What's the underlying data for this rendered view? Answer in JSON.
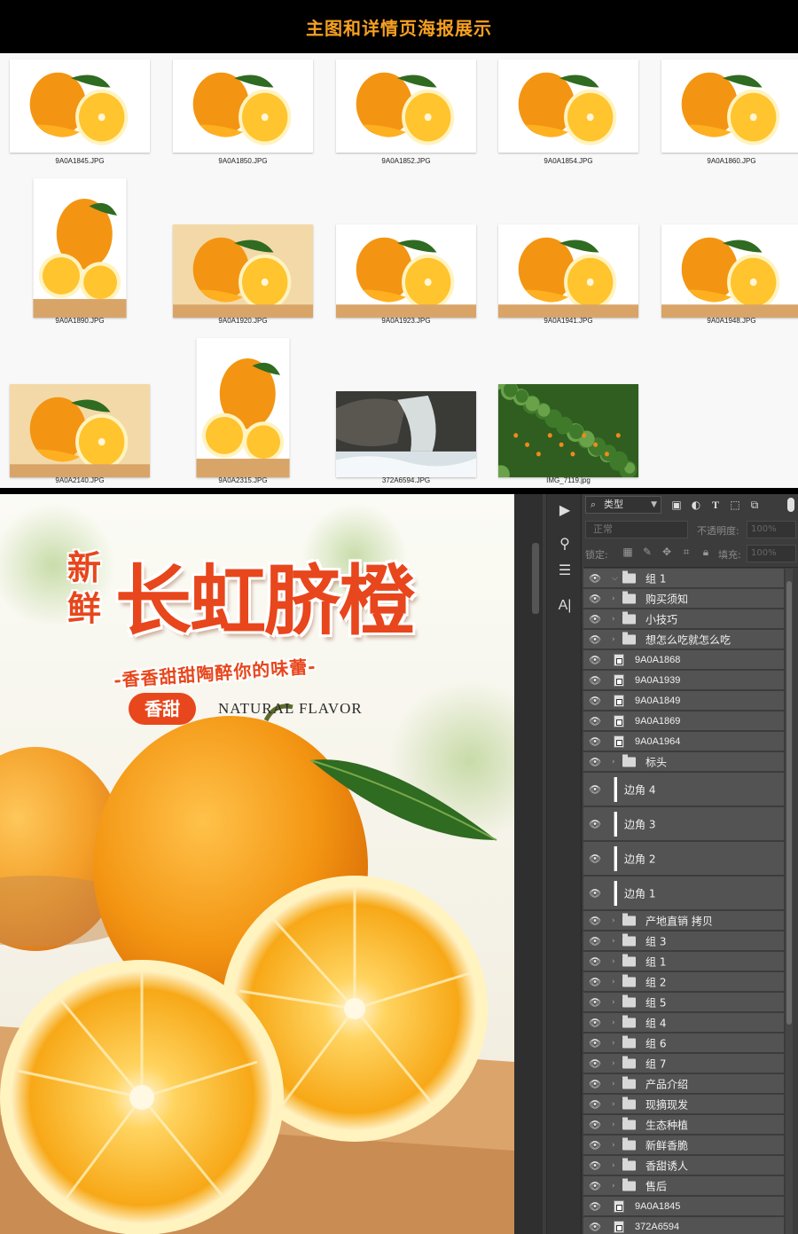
{
  "header": {
    "title": "主图和详情页海报展示"
  },
  "thumbnails": [
    {
      "name": "9A0A1845.JPG",
      "variant": "a"
    },
    {
      "name": "9A0A1850.JPG",
      "variant": "b"
    },
    {
      "name": "9A0A1852.JPG",
      "variant": "c"
    },
    {
      "name": "9A0A1854.JPG",
      "variant": "d"
    },
    {
      "name": "9A0A1860.JPG",
      "variant": "e"
    },
    {
      "name": "9A0A1890.JPG",
      "variant": "f"
    },
    {
      "name": "9A0A1920.JPG",
      "variant": "g"
    },
    {
      "name": "9A0A1923.JPG",
      "variant": "h"
    },
    {
      "name": "9A0A1941.JPG",
      "variant": "i"
    },
    {
      "name": "9A0A1948.JPG",
      "variant": "j"
    },
    {
      "name": "9A0A2140.JPG",
      "variant": "k"
    },
    {
      "name": "9A0A2315.JPG",
      "variant": "l"
    },
    {
      "name": "372A6594.JPG",
      "variant": "water"
    },
    {
      "name": "IMG_7119.jpg",
      "variant": "tree"
    }
  ],
  "poster": {
    "fresh": "新鲜",
    "title": "长虹脐橙",
    "slogan": "-香香甜甜陶醉你的味蕾-",
    "badge": "香甜",
    "natural": "NATURAL FLAVOR"
  },
  "photoshop": {
    "filter_kind": "类型",
    "blend_mode": "正常",
    "opacity_label": "不透明度:",
    "opacity_value": "100%",
    "lock_label": "锁定:",
    "fill_label": "填充:",
    "fill_value": "100%",
    "layers": [
      {
        "label": "组 1",
        "type": "folder",
        "expanded": true
      },
      {
        "label": "购买须知",
        "type": "folder"
      },
      {
        "label": "小技巧",
        "type": "folder"
      },
      {
        "label": "想怎么吃就怎么吃",
        "type": "folder"
      },
      {
        "label": "9A0A1868",
        "type": "smart"
      },
      {
        "label": "9A0A1939",
        "type": "smart"
      },
      {
        "label": "9A0A1849",
        "type": "smart"
      },
      {
        "label": "9A0A1869",
        "type": "smart"
      },
      {
        "label": "9A0A1964",
        "type": "smart"
      },
      {
        "label": "标头",
        "type": "folder"
      },
      {
        "label": "边角 4",
        "type": "shape"
      },
      {
        "label": "边角 3",
        "type": "shape"
      },
      {
        "label": "边角 2",
        "type": "shape"
      },
      {
        "label": "边角 1",
        "type": "shape"
      },
      {
        "label": "产地直销 拷贝",
        "type": "folder"
      },
      {
        "label": "组 3",
        "type": "folder"
      },
      {
        "label": "组 1",
        "type": "folder"
      },
      {
        "label": "组 2",
        "type": "folder"
      },
      {
        "label": "组 5",
        "type": "folder"
      },
      {
        "label": "组 4",
        "type": "folder"
      },
      {
        "label": "组 6",
        "type": "folder"
      },
      {
        "label": "组 7",
        "type": "folder"
      },
      {
        "label": "产品介绍",
        "type": "folder"
      },
      {
        "label": "现摘现发",
        "type": "folder"
      },
      {
        "label": "生态种植",
        "type": "folder"
      },
      {
        "label": "新鲜香脆",
        "type": "folder"
      },
      {
        "label": "香甜诱人",
        "type": "folder"
      },
      {
        "label": "售后",
        "type": "folder"
      },
      {
        "label": "9A0A1845",
        "type": "smart"
      },
      {
        "label": "372A6594",
        "type": "smart"
      }
    ]
  },
  "colors": {
    "accent": "#f6a020",
    "poster_red": "#e8461c",
    "orange": "#f39a14"
  }
}
